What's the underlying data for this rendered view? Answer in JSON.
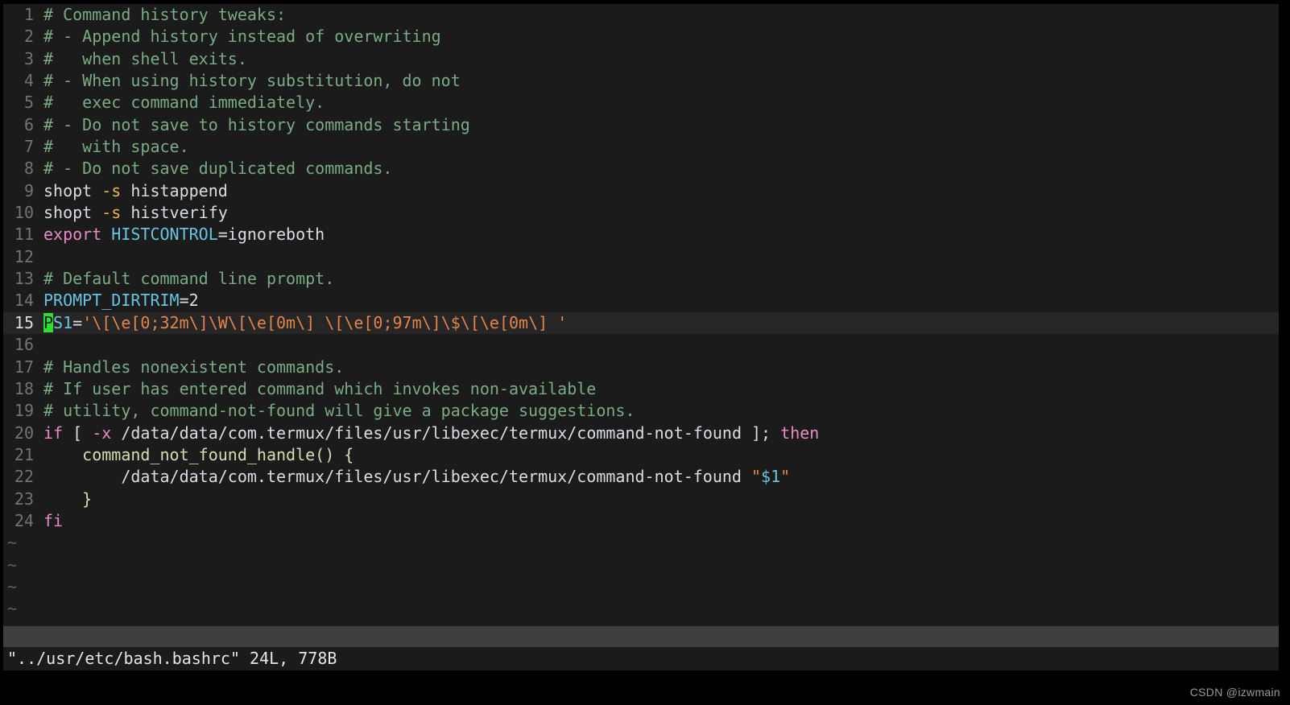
{
  "editor": {
    "app": "vim",
    "file_name": "../usr/etc/bash.bashrc",
    "cursor_line": 15,
    "cursor_col": 1,
    "total_lines": 24,
    "colors": {
      "background": "#1b1b1b",
      "current_line_bg": "#262626",
      "outer_border": "#000000",
      "statusline_bg": "#3f3f3f",
      "line_number": "#6f7477",
      "line_number_current": "#d8dee4",
      "comment": "#7aab84",
      "keyword": "#e88bc4",
      "identifier": "#65c4e3",
      "string": "#e5844a",
      "option": "#e8b84b",
      "function": "#d8dbb0",
      "plain_text": "#d8dee4",
      "cursor_bg": "#2ee02e",
      "tilde": "#5b6063"
    },
    "lines": [
      {
        "num": "1",
        "current": false,
        "tokens": [
          {
            "t": "# Command history tweaks:",
            "c": "c-comment"
          }
        ]
      },
      {
        "num": "2",
        "current": false,
        "tokens": [
          {
            "t": "# - Append history instead of overwriting",
            "c": "c-comment"
          }
        ]
      },
      {
        "num": "3",
        "current": false,
        "tokens": [
          {
            "t": "#   when shell exits.",
            "c": "c-comment"
          }
        ]
      },
      {
        "num": "4",
        "current": false,
        "tokens": [
          {
            "t": "# - When using history substitution, do not",
            "c": "c-comment"
          }
        ]
      },
      {
        "num": "5",
        "current": false,
        "tokens": [
          {
            "t": "#   exec command immediately.",
            "c": "c-comment"
          }
        ]
      },
      {
        "num": "6",
        "current": false,
        "tokens": [
          {
            "t": "# - Do not save to history commands starting",
            "c": "c-comment"
          }
        ]
      },
      {
        "num": "7",
        "current": false,
        "tokens": [
          {
            "t": "#   with space.",
            "c": "c-comment"
          }
        ]
      },
      {
        "num": "8",
        "current": false,
        "tokens": [
          {
            "t": "# - Do not save duplicated commands.",
            "c": "c-comment"
          }
        ]
      },
      {
        "num": "9",
        "current": false,
        "tokens": [
          {
            "t": "shopt ",
            "c": "c-plain"
          },
          {
            "t": "-s",
            "c": "c-opt"
          },
          {
            "t": " histappend",
            "c": "c-plain"
          }
        ]
      },
      {
        "num": "10",
        "current": false,
        "tokens": [
          {
            "t": "shopt ",
            "c": "c-plain"
          },
          {
            "t": "-s",
            "c": "c-opt"
          },
          {
            "t": " histverify",
            "c": "c-plain"
          }
        ]
      },
      {
        "num": "11",
        "current": false,
        "tokens": [
          {
            "t": "export",
            "c": "c-kw"
          },
          {
            "t": " ",
            "c": "c-plain"
          },
          {
            "t": "HISTCONTROL",
            "c": "c-ident"
          },
          {
            "t": "=ignoreboth",
            "c": "c-plain"
          }
        ]
      },
      {
        "num": "12",
        "current": false,
        "tokens": [
          {
            "t": "",
            "c": "c-plain"
          }
        ]
      },
      {
        "num": "13",
        "current": false,
        "tokens": [
          {
            "t": "# Default command line prompt.",
            "c": "c-comment"
          }
        ]
      },
      {
        "num": "14",
        "current": false,
        "tokens": [
          {
            "t": "PROMPT_DIRTRIM",
            "c": "c-ident"
          },
          {
            "t": "=2",
            "c": "c-plain"
          }
        ]
      },
      {
        "num": "15",
        "current": true,
        "tokens": [
          {
            "t": "P",
            "c": "cursor"
          },
          {
            "t": "S1",
            "c": "c-ident"
          },
          {
            "t": "=",
            "c": "c-plain"
          },
          {
            "t": "'\\[\\e[0;32m\\]\\W\\[\\e[0m\\] \\[\\e[0;97m\\]\\$\\[\\e[0m\\] '",
            "c": "c-str"
          }
        ]
      },
      {
        "num": "16",
        "current": false,
        "tokens": [
          {
            "t": "",
            "c": "c-plain"
          }
        ]
      },
      {
        "num": "17",
        "current": false,
        "tokens": [
          {
            "t": "# Handles nonexistent commands.",
            "c": "c-comment"
          }
        ]
      },
      {
        "num": "18",
        "current": false,
        "tokens": [
          {
            "t": "# If user has entered command which invokes non-available",
            "c": "c-comment"
          }
        ]
      },
      {
        "num": "19",
        "current": false,
        "tokens": [
          {
            "t": "# utility, command-not-found will give a package suggestions.",
            "c": "c-comment"
          }
        ]
      },
      {
        "num": "20",
        "current": false,
        "tokens": [
          {
            "t": "if",
            "c": "c-kw"
          },
          {
            "t": " [ ",
            "c": "c-plain"
          },
          {
            "t": "-x",
            "c": "c-kw"
          },
          {
            "t": " /data/data/com.termux/files/usr/libexec/termux/command-not-found ]; ",
            "c": "c-plain"
          },
          {
            "t": "then",
            "c": "c-kw"
          }
        ]
      },
      {
        "num": "21",
        "current": false,
        "tokens": [
          {
            "t": "    command_not_found_handle() {",
            "c": "c-func"
          }
        ]
      },
      {
        "num": "22",
        "current": false,
        "tokens": [
          {
            "t": "        /data/data/com.termux/files/usr/libexec/termux/command-not-found ",
            "c": "c-plain"
          },
          {
            "t": "\"",
            "c": "c-str"
          },
          {
            "t": "$1",
            "c": "c-ident"
          },
          {
            "t": "\"",
            "c": "c-str"
          }
        ]
      },
      {
        "num": "23",
        "current": false,
        "tokens": [
          {
            "t": "    }",
            "c": "c-brace"
          }
        ]
      },
      {
        "num": "24",
        "current": false,
        "tokens": [
          {
            "t": "fi",
            "c": "c-kw"
          }
        ]
      }
    ],
    "tilde_rows": [
      "~",
      "~",
      "~",
      "~"
    ],
    "statusline": {
      "text": ""
    },
    "message_line": "\"../usr/etc/bash.bashrc\" 24L, 778B"
  },
  "watermark": {
    "text": "CSDN @izwmain"
  }
}
